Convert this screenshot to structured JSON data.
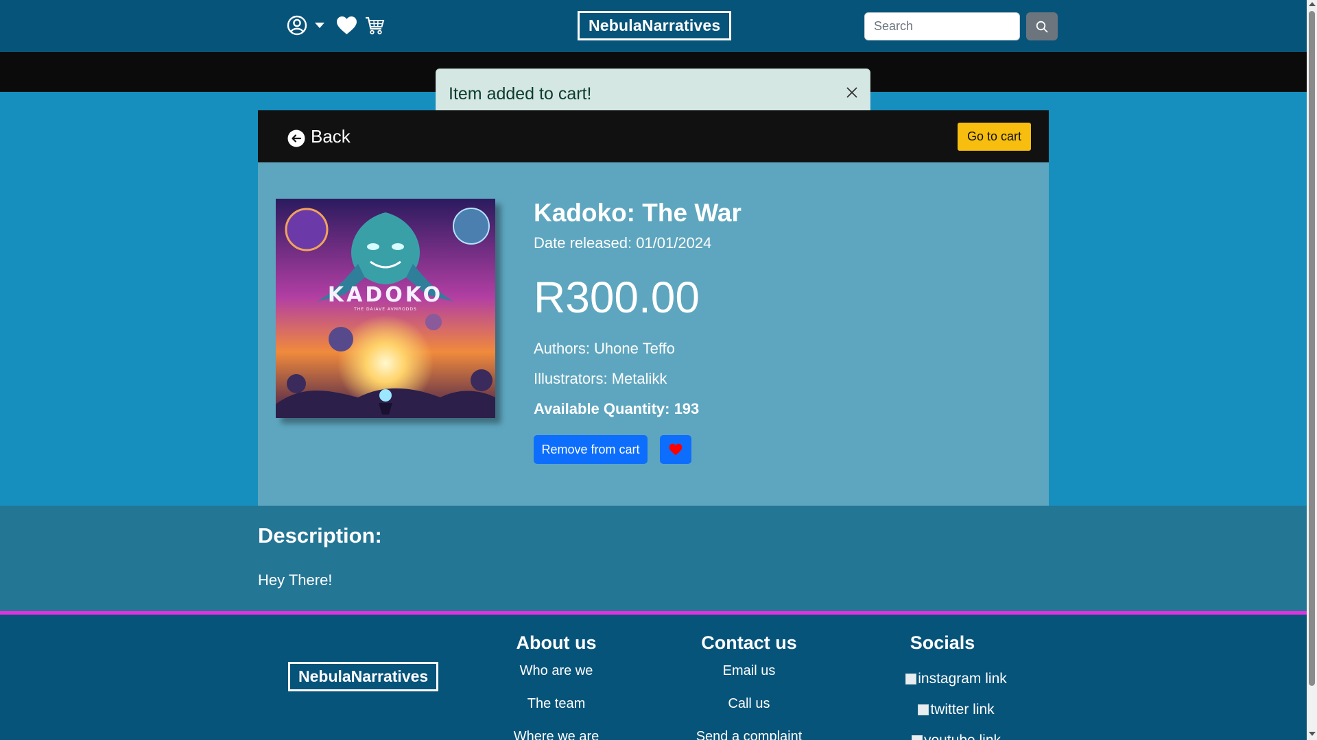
{
  "header": {
    "brand": "NebulaNarratives",
    "icons": [
      "user-circle-icon",
      "caret-down-icon",
      "heart-icon",
      "cart-icon"
    ],
    "search_placeholder": "Search",
    "search_icon": "search-icon"
  },
  "toast": {
    "message": "Item added to cart!",
    "close_icon": "close-icon",
    "background": "#d4e7e3"
  },
  "card": {
    "back_label": "Back",
    "back_icon": "arrow-left-circle-icon",
    "go_to_cart": "Go to cart",
    "cover_title": "KADOKO",
    "cover_subtitle": "THE DAIAVE AVMRODDS",
    "title": "Kadoko: The War",
    "date_released": "Date released: 01/01/2024",
    "price": "R300.00",
    "authors": "Authors: Uhone Teffo",
    "illustrators": "Illustrators: Metalikk",
    "available_quantity": "Available Quantity: 193",
    "remove_button": "Remove from cart",
    "favorite_icon": "heart-icon"
  },
  "description": {
    "heading": "Description:",
    "text": "Hey There!"
  },
  "footer": {
    "brand": "NebulaNarratives",
    "about": {
      "heading": "About us",
      "links": [
        "Who are we",
        "The team",
        "Where we are"
      ]
    },
    "contact": {
      "heading": "Contact us",
      "links": [
        "Email us",
        "Call us",
        "Send a complaint"
      ]
    },
    "socials": {
      "heading": "Socials",
      "links": [
        "instagram link",
        "twitter link",
        "youtube link"
      ]
    }
  },
  "colors": {
    "navbar": "#07547a",
    "page_background": "#168fbe",
    "card_body": "#5ea6bf",
    "description_band": "#247695",
    "accent_line": "#e530e0",
    "primary_button": "#0d6efd",
    "go_to_cart_button": "#f7be0f"
  }
}
